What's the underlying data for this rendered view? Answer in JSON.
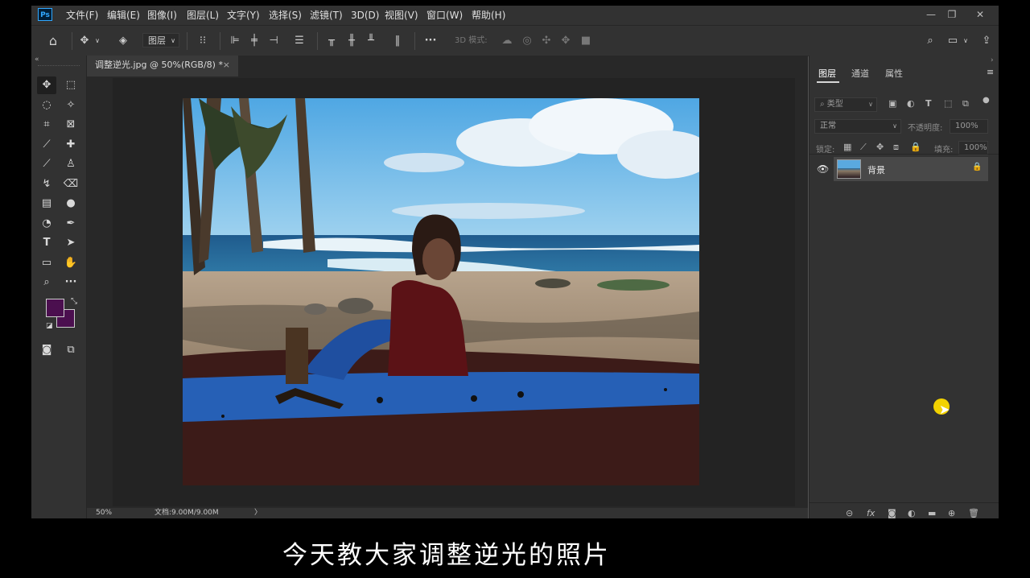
{
  "app": {
    "logo": "Ps",
    "menu": [
      "文件(F)",
      "编辑(E)",
      "图像(I)",
      "图层(L)",
      "文字(Y)",
      "选择(S)",
      "滤镜(T)",
      "3D(D)",
      "视图(V)",
      "窗口(W)",
      "帮助(H)"
    ],
    "window_controls": [
      "minimize-icon",
      "restore-icon",
      "close-icon"
    ]
  },
  "options_bar": {
    "layer_select": "图层",
    "mode_3d_label": "3D 模式:"
  },
  "document": {
    "tab_title": "调整逆光.jpg @ 50%(RGB/8) *",
    "tab_close": "×",
    "zoom": "50%",
    "doc_info": "文档:9.00M/9.00M",
    "status_arrow": "〉"
  },
  "colors": {
    "foreground": "#4b0f4f",
    "background": "#4b0f4f",
    "accent": "#31a8ff"
  },
  "layers_panel": {
    "tabs": [
      "图层",
      "通道",
      "属性"
    ],
    "filter_kind": "类型",
    "blend_mode": "正常",
    "opacity_label": "不透明度:",
    "opacity_value": "100%",
    "lock_label": "锁定:",
    "fill_label": "填充:",
    "fill_value": "100%",
    "layers": [
      {
        "name": "背景",
        "visible": true,
        "locked": true
      }
    ]
  },
  "subtitle": "今天教大家调整逆光的照片"
}
